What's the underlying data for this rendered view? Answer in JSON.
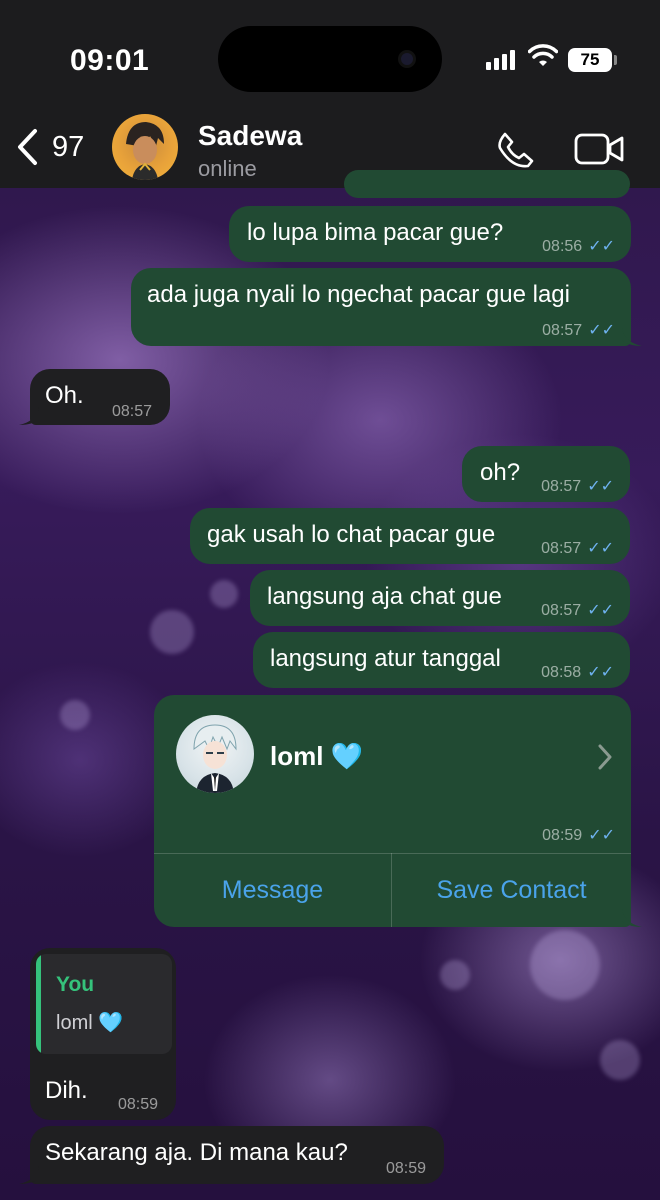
{
  "status_bar": {
    "time": "09:01",
    "battery": "75"
  },
  "header": {
    "back_count": "97",
    "contact_name": "Sadewa",
    "contact_status": "online"
  },
  "messages": [
    {
      "direction": "out",
      "text": "lo lupa bima pacar gue?",
      "time": "08:56"
    },
    {
      "direction": "out",
      "text": "ada juga nyali lo ngechat pacar gue lagi",
      "time": "08:57"
    },
    {
      "direction": "in",
      "text": "Oh.",
      "time": "08:57"
    },
    {
      "direction": "out",
      "text": "oh?",
      "time": "08:57"
    },
    {
      "direction": "out",
      "text": "gak usah lo chat pacar gue",
      "time": "08:57"
    },
    {
      "direction": "out",
      "text": "langsung aja chat gue",
      "time": "08:57"
    },
    {
      "direction": "out",
      "text": "langsung atur tanggal",
      "time": "08:58"
    },
    {
      "direction": "in",
      "text": "Dih.",
      "time": "08:59"
    },
    {
      "direction": "in",
      "text": "Sekarang aja. Di mana kau?",
      "time": "08:59"
    }
  ],
  "contact_card": {
    "name": "loml 🩵",
    "time": "08:59",
    "message_label": "Message",
    "save_label": "Save Contact"
  },
  "reply": {
    "sender": "You",
    "text": "loml 🩵"
  },
  "colors": {
    "outgoing_bubble": "#214a33",
    "incoming_bubble": "#1f1f21",
    "read_ticks": "#6fb2f0",
    "link": "#4aa3ea",
    "reply_accent": "#35c27b"
  }
}
